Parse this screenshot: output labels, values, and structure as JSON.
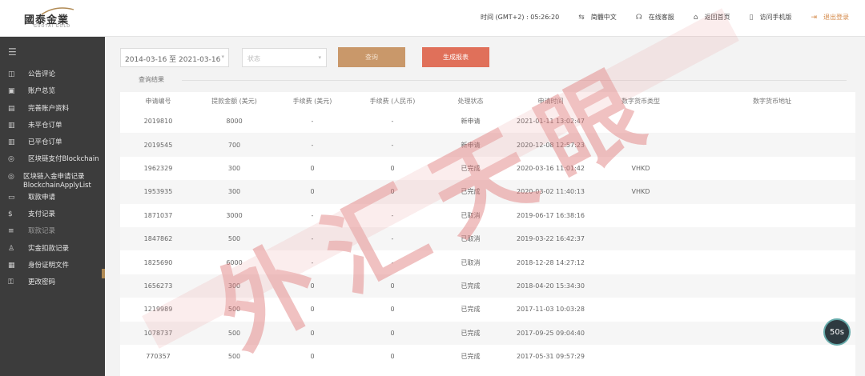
{
  "header": {
    "logo_cn": "國泰金業",
    "logo_en": "GUOTAI GOLD",
    "time_label": "时间 (GMT+2) : 05:26:20",
    "lang": "简體中文",
    "online_service": "在线客服",
    "back_home": "返回首页",
    "mobile": "访问手机版",
    "logout": "退出登录"
  },
  "sidebar": {
    "items": [
      {
        "label": "公告评论",
        "icon": "megaphone-icon"
      },
      {
        "label": "账户总览",
        "icon": "wallet-icon"
      },
      {
        "label": "完善账户资料",
        "icon": "id-card-icon"
      },
      {
        "label": "未平仓订单",
        "icon": "document-icon"
      },
      {
        "label": "已平仓订单",
        "icon": "document-icon"
      },
      {
        "label": "区块链支付Blockchain",
        "icon": "coin-icon"
      },
      {
        "label": "区块链入金申请记录 BlockchainApplyList",
        "icon": "coin-icon"
      },
      {
        "label": "取款申请",
        "icon": "card-icon"
      },
      {
        "label": "支付记录",
        "icon": "dollar-icon"
      },
      {
        "label": "取款记录",
        "icon": "list-icon"
      },
      {
        "label": "实金扣款记录",
        "icon": "user-icon"
      },
      {
        "label": "身份证明文件",
        "icon": "file-icon"
      },
      {
        "label": "更改密码",
        "icon": "lock-icon"
      }
    ]
  },
  "filters": {
    "date_range": "2014-03-16 至 2021-03-16",
    "status_placeholder": "状态",
    "query_btn": "查询",
    "report_btn": "生成报表"
  },
  "results_tab": "查询结果",
  "table": {
    "headers": [
      "申请编号",
      "提款金额 (美元)",
      "手续费 (美元)",
      "手续费 (人民币)",
      "处理状态",
      "申请时间",
      "数字货币类型",
      "数字货币地址"
    ],
    "rows": [
      [
        "2019810",
        "8000",
        "-",
        "-",
        "新申请",
        "2021-01-11 13:02:47",
        "",
        ""
      ],
      [
        "2019545",
        "700",
        "-",
        "-",
        "新申请",
        "2020-12-08 12:57:23",
        "",
        ""
      ],
      [
        "1962329",
        "300",
        "0",
        "0",
        "已完成",
        "2020-03-16 11:01:42",
        "VHKD",
        ""
      ],
      [
        "1953935",
        "300",
        "0",
        "0",
        "已完成",
        "2020-03-02 11:40:13",
        "VHKD",
        ""
      ],
      [
        "1871037",
        "3000",
        "-",
        "-",
        "已取消",
        "2019-06-17 16:38:16",
        "",
        ""
      ],
      [
        "1847862",
        "500",
        "-",
        "-",
        "已取消",
        "2019-03-22 16:42:37",
        "",
        ""
      ],
      [
        "1825690",
        "6000",
        "-",
        "-",
        "已取消",
        "2018-12-28 14:27:12",
        "",
        ""
      ],
      [
        "1656273",
        "300",
        "0",
        "0",
        "已完成",
        "2018-04-20 15:34:30",
        "",
        ""
      ],
      [
        "1219989",
        "500",
        "0",
        "0",
        "已完成",
        "2017-11-03 10:03:28",
        "",
        ""
      ],
      [
        "1078737",
        "500",
        "0",
        "0",
        "已完成",
        "2017-09-25 09:04:40",
        "",
        ""
      ],
      [
        "770357",
        "500",
        "0",
        "0",
        "已完成",
        "2017-05-31 09:57:29",
        "",
        ""
      ]
    ]
  },
  "timer_badge": "50s",
  "watermark_text": "外汇天眼"
}
